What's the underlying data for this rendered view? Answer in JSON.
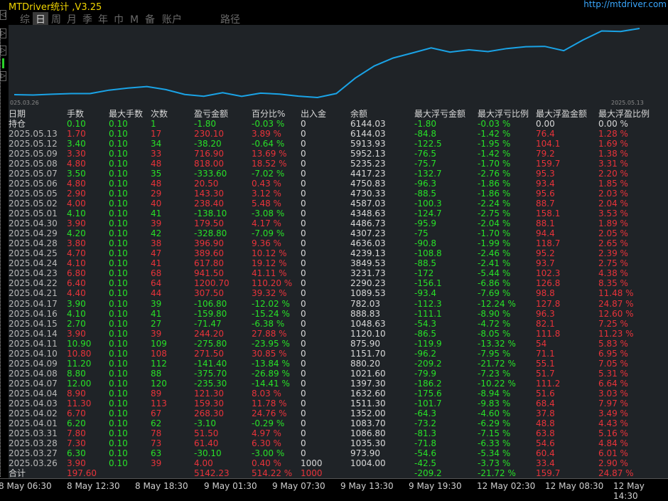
{
  "app": {
    "title": "MTDriver统计 ,V3.25",
    "url": "http://mtdriver.com"
  },
  "tabs": [
    "综",
    "日",
    "周",
    "月",
    "季",
    "年",
    "巾",
    "M",
    "备",
    "账户"
  ],
  "active_tab": 1,
  "path_label": "路径",
  "left_nav": [
    "◁",
    "▷",
    "▷",
    "▷"
  ],
  "chart": {
    "start_label": "025.03.26",
    "end_label": "2025.05.13",
    "line_color": "#1aa3e6",
    "series": [
      1004.0,
      973.9,
      1035.3,
      1086.8,
      1083.7,
      1352.0,
      1511.3,
      1632.6,
      1397.3,
      1021.6,
      880.2,
      1151.7,
      875.9,
      1120.1,
      1048.63,
      888.83,
      782.03,
      1089.53,
      2290.23,
      3231.73,
      3849.53,
      4239.13,
      4636.03,
      4307.23,
      4486.73,
      4348.63,
      4587.03,
      4730.33,
      4750.83,
      4417.23,
      5235.23,
      5952.13,
      5913.93,
      6144.03
    ]
  },
  "table": {
    "headers": [
      "日期",
      "手数",
      "最大手数",
      "次数",
      "盈亏金额",
      "百分比%",
      "出入金",
      "余额",
      "最大浮亏金额",
      "最大浮亏比例",
      "最大浮盈金额",
      "最大浮盈比例"
    ],
    "holding": [
      "持仓",
      "0.10",
      "0.10",
      "1",
      "-1.80",
      "-0.03 %",
      "0",
      "6144.03",
      "-1.80",
      "-0.03 %",
      "0.00",
      "0.00 %"
    ],
    "rows": [
      [
        "2025.05.13",
        "1.70",
        "0.10",
        "17",
        "230.10",
        "3.89 %",
        "0",
        "6144.03",
        "-84.8",
        "-1.42 %",
        "76.4",
        "1.28 %"
      ],
      [
        "2025.05.12",
        "3.40",
        "0.10",
        "34",
        "-38.20",
        "-0.64 %",
        "0",
        "5913.93",
        "-122.5",
        "-1.95 %",
        "104.1",
        "1.69 %"
      ],
      [
        "2025.05.09",
        "3.30",
        "0.10",
        "33",
        "716.90",
        "13.69 %",
        "0",
        "5952.13",
        "-76.5",
        "-1.42 %",
        "79.2",
        "1.38 %"
      ],
      [
        "2025.05.08",
        "4.80",
        "0.10",
        "48",
        "818.00",
        "18.52 %",
        "0",
        "5235.23",
        "-75.7",
        "-1.70 %",
        "159.7",
        "3.31 %"
      ],
      [
        "2025.05.07",
        "3.50",
        "0.10",
        "35",
        "-333.60",
        "-7.02 %",
        "0",
        "4417.23",
        "-132.7",
        "-2.76 %",
        "95.3",
        "2.20 %"
      ],
      [
        "2025.05.06",
        "4.80",
        "0.10",
        "48",
        "20.50",
        "0.43 %",
        "0",
        "4750.83",
        "-96.3",
        "-1.86 %",
        "93.4",
        "1.85 %"
      ],
      [
        "2025.05.05",
        "2.90",
        "0.10",
        "29",
        "143.30",
        "3.12 %",
        "0",
        "4730.33",
        "-88.5",
        "-1.86 %",
        "95.6",
        "2.03 %"
      ],
      [
        "2025.05.02",
        "4.00",
        "0.10",
        "40",
        "238.40",
        "5.48 %",
        "0",
        "4587.03",
        "-100.3",
        "-2.24 %",
        "88.7",
        "2.04 %"
      ],
      [
        "2025.05.01",
        "4.10",
        "0.10",
        "41",
        "-138.10",
        "-3.08 %",
        "0",
        "4348.63",
        "-124.7",
        "-2.75 %",
        "158.1",
        "3.53 %"
      ],
      [
        "2025.04.30",
        "3.90",
        "0.10",
        "39",
        "179.50",
        "4.17 %",
        "0",
        "4486.73",
        "-95.9",
        "-2.04 %",
        "88.1",
        "1.89 %"
      ],
      [
        "2025.04.29",
        "4.20",
        "0.10",
        "42",
        "-328.80",
        "-7.09 %",
        "0",
        "4307.23",
        "-75",
        "-1.70 %",
        "94.4",
        "2.05 %"
      ],
      [
        "2025.04.28",
        "3.80",
        "0.10",
        "38",
        "396.90",
        "9.36 %",
        "0",
        "4636.03",
        "-90.8",
        "-1.99 %",
        "118.7",
        "2.65 %"
      ],
      [
        "2025.04.25",
        "4.70",
        "0.10",
        "47",
        "389.60",
        "10.12 %",
        "0",
        "4239.13",
        "-108.8",
        "-2.46 %",
        "95.2",
        "2.39 %"
      ],
      [
        "2025.04.24",
        "4.10",
        "0.10",
        "41",
        "617.80",
        "19.12 %",
        "0",
        "3849.53",
        "-88.5",
        "-2.41 %",
        "93.7",
        "2.75 %"
      ],
      [
        "2025.04.23",
        "6.80",
        "0.10",
        "68",
        "941.50",
        "41.11 %",
        "0",
        "3231.73",
        "-172",
        "-5.44 %",
        "102.3",
        "4.38 %"
      ],
      [
        "2025.04.22",
        "6.40",
        "0.10",
        "64",
        "1200.70",
        "110.20 %",
        "0",
        "2290.23",
        "-156.1",
        "-6.86 %",
        "126.8",
        "8.35 %"
      ],
      [
        "2025.04.21",
        "4.40",
        "0.10",
        "44",
        "307.50",
        "39.32 %",
        "0",
        "1089.53",
        "-93.4",
        "-7.69 %",
        "98.8",
        "11.48 %"
      ],
      [
        "2025.04.17",
        "3.90",
        "0.10",
        "39",
        "-106.80",
        "-12.02 %",
        "0",
        "782.03",
        "-112.3",
        "-12.24 %",
        "127.8",
        "24.87 %"
      ],
      [
        "2025.04.16",
        "4.10",
        "0.10",
        "41",
        "-159.80",
        "-15.24 %",
        "0",
        "888.83",
        "-111.1",
        "-8.90 %",
        "96.3",
        "12.60 %"
      ],
      [
        "2025.04.15",
        "2.70",
        "0.10",
        "27",
        "-71.47",
        "-6.38 %",
        "0",
        "1048.63",
        "-54.3",
        "-4.72 %",
        "82.1",
        "7.25 %"
      ],
      [
        "2025.04.14",
        "3.90",
        "0.10",
        "39",
        "244.20",
        "27.88 %",
        "0",
        "1120.10",
        "-86.5",
        "-8.05 %",
        "111.8",
        "11.23 %"
      ],
      [
        "2025.04.11",
        "10.90",
        "0.10",
        "109",
        "-275.80",
        "-23.95 %",
        "0",
        "875.90",
        "-119.9",
        "-13.32 %",
        "54",
        "5.83 %"
      ],
      [
        "2025.04.10",
        "10.80",
        "0.10",
        "108",
        "271.50",
        "30.85 %",
        "0",
        "1151.70",
        "-96.2",
        "-7.95 %",
        "71.1",
        "6.95 %"
      ],
      [
        "2025.04.09",
        "11.20",
        "0.10",
        "112",
        "-141.40",
        "-13.84 %",
        "0",
        "880.20",
        "-209.2",
        "-21.72 %",
        "55.1",
        "7.05 %"
      ],
      [
        "2025.04.08",
        "8.80",
        "0.10",
        "88",
        "-375.70",
        "-26.89 %",
        "0",
        "1021.60",
        "-79.9",
        "-7.23 %",
        "51.7",
        "5.31 %"
      ],
      [
        "2025.04.07",
        "12.00",
        "0.10",
        "120",
        "-235.30",
        "-14.41 %",
        "0",
        "1397.30",
        "-186.2",
        "-10.22 %",
        "111.2",
        "6.64 %"
      ],
      [
        "2025.04.04",
        "8.90",
        "0.10",
        "89",
        "121.30",
        "8.03 %",
        "0",
        "1632.60",
        "-175.6",
        "-8.94 %",
        "51.6",
        "3.03 %"
      ],
      [
        "2025.04.03",
        "11.30",
        "0.10",
        "113",
        "159.30",
        "11.78 %",
        "0",
        "1511.30",
        "-101.7",
        "-9.83 %",
        "68.4",
        "7.97 %"
      ],
      [
        "2025.04.02",
        "6.70",
        "0.10",
        "67",
        "268.30",
        "24.76 %",
        "0",
        "1352.00",
        "-64.3",
        "-4.60 %",
        "37.8",
        "3.49 %"
      ],
      [
        "2025.04.01",
        "6.20",
        "0.10",
        "62",
        "-3.10",
        "-0.29 %",
        "0",
        "1083.70",
        "-73.2",
        "-6.29 %",
        "48.8",
        "4.43 %"
      ],
      [
        "2025.03.31",
        "7.80",
        "0.10",
        "78",
        "51.50",
        "4.97 %",
        "0",
        "1086.80",
        "-81.3",
        "-7.15 %",
        "63.8",
        "5.16 %"
      ],
      [
        "2025.03.28",
        "7.30",
        "0.10",
        "73",
        "61.40",
        "6.30 %",
        "0",
        "1035.30",
        "-71.8",
        "-6.33 %",
        "54.6",
        "4.84 %"
      ],
      [
        "2025.03.27",
        "6.30",
        "0.10",
        "63",
        "-30.10",
        "-3.00 %",
        "0",
        "973.90",
        "-54.6",
        "-5.34 %",
        "60.4",
        "6.01 %"
      ],
      [
        "2025.03.26",
        "3.90",
        "0.10",
        "39",
        "4.00",
        "0.40 %",
        "1000",
        "1004.00",
        "-42.5",
        "-3.73 %",
        "33.4",
        "2.90 %"
      ]
    ],
    "total": [
      "合计",
      "197.60",
      "",
      "",
      "5142.23",
      "514.22 %",
      "1000",
      "",
      "-209.2",
      "-21.72 %",
      "159.7",
      "24.87 %"
    ]
  },
  "time_axis": [
    "8 May 06:30",
    "8 May 12:30",
    "8 May 18:30",
    "9 May 01:30",
    "9 May 07:30",
    "9 May 13:30",
    "9 May 19:30",
    "12 May 02:30",
    "12 May 08:30",
    "12 May 14:30"
  ],
  "colors": {
    "profit": "#e8333a",
    "loss": "#28e028",
    "neutral": "#d8d8d8",
    "title": "#f0d400",
    "url": "#3aa8ff"
  }
}
